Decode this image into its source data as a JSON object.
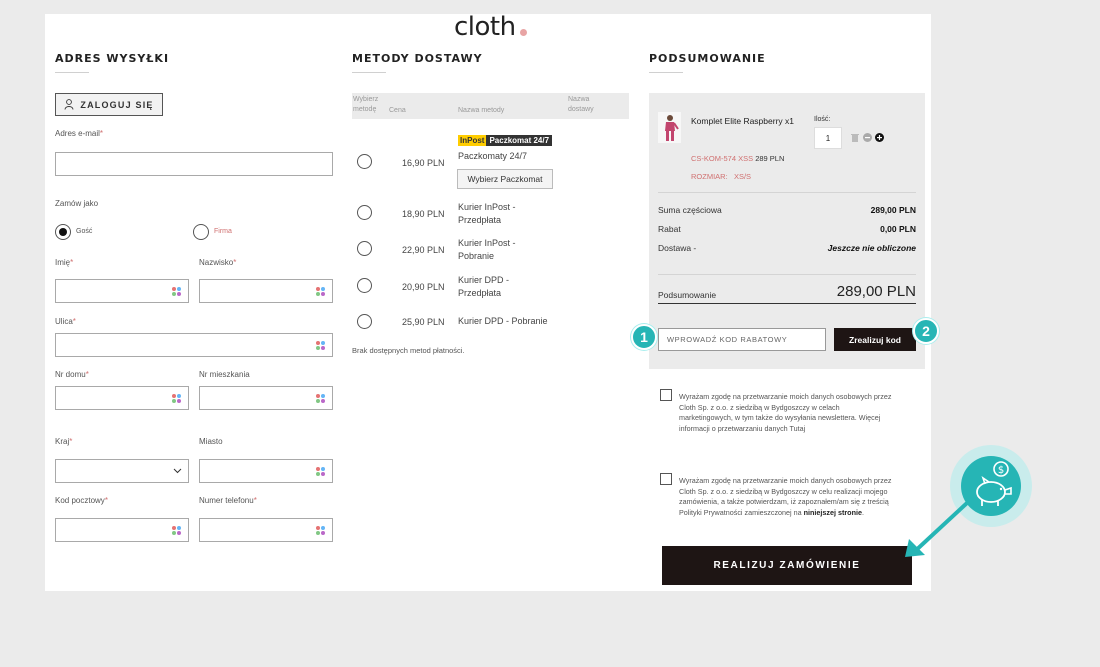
{
  "brand": {
    "name": "cloth",
    "accent": "#e8a4a4"
  },
  "shipping": {
    "title": "ADRES WYSYŁKI",
    "login_label": "ZALOGUJ SIĘ",
    "email_label": "Adres e-mail",
    "order_as_label": "Zamów jako",
    "guest_label": "Gość",
    "company_label": "Firma",
    "first_name_label": "Imię",
    "last_name_label": "Nazwisko",
    "street_label": "Ulica",
    "house_no_label": "Nr domu",
    "apt_no_label": "Nr mieszkania",
    "country_label": "Kraj",
    "city_label": "Miasto",
    "postal_label": "Kod pocztowy",
    "phone_label": "Numer telefonu",
    "required_mark": "*"
  },
  "delivery": {
    "title": "METODY DOSTAWY",
    "col_select": "Wybierz metodę",
    "col_price": "Cena",
    "col_name": "Nazwa metody",
    "col_delivery_name": "Nazwa dostawy",
    "inpost_tag": "InPost",
    "paczkomat_tag": "Paczkomat 24/7",
    "paczkomat_btn": "Wybierz Paczkomat",
    "methods": [
      {
        "price": "16,90 PLN",
        "line1": "Paczkomaty 24/7",
        "line2": ""
      },
      {
        "price": "18,90 PLN",
        "line1": "Kurier InPost -",
        "line2": "Przedpłata"
      },
      {
        "price": "22,90 PLN",
        "line1": "Kurier InPost -",
        "line2": "Pobranie"
      },
      {
        "price": "20,90 PLN",
        "line1": "Kurier DPD -",
        "line2": "Przedpłata"
      },
      {
        "price": "25,90 PLN",
        "line1": "Kurier DPD - Pobranie",
        "line2": ""
      }
    ],
    "no_payment": "Brak dostępnych metod płatności."
  },
  "summary": {
    "title": "PODSUMOWANIE",
    "product_name": "Komplet Elite Raspberry x1",
    "qty_label": "Ilość:",
    "qty_value": "1",
    "sku": "CS-KOM-574 XSS",
    "sku_price": "289 PLN",
    "size_label": "ROZMIAR:",
    "size_value": "XS/S",
    "subtotal_label": "Suma częściowa",
    "subtotal_value": "289,00 PLN",
    "discount_label": "Rabat",
    "discount_value": "0,00 PLN",
    "shipping_label": "Dostawa -",
    "shipping_value": "Jeszcze nie obliczone",
    "total_label": "Podsumowanie",
    "total_value": "289,00 PLN",
    "coupon_placeholder": "WPROWADŹ KOD RABATOWY",
    "coupon_btn": "Zrealizuj kod",
    "consent1": "Wyrażam zgodę na przetwarzanie moich danych osobowych przez Cloth Sp. z o.o. z siedzibą w Bydgoszczy w celach marketingowych, w tym także do wysyłania newslettera. Więcej informacji o przetwarzaniu danych Tutaj",
    "consent2_a": "Wyrażam zgodę na przetwarzanie moich danych osobowych przez Cloth Sp. z o.o. z siedzibą w Bydgoszczy w celu realizacji mojego zamówienia, a także potwierdzam, iż zapoznałem/am się z treścią Polityki Prywatności zamieszczonej na",
    "consent2_link": "niniejszej stronie",
    "order_btn": "REALIZUJ ZAMÓWIENIE"
  },
  "annotations": {
    "badge1": "1",
    "badge2": "2",
    "teal": "#26b5b5"
  }
}
